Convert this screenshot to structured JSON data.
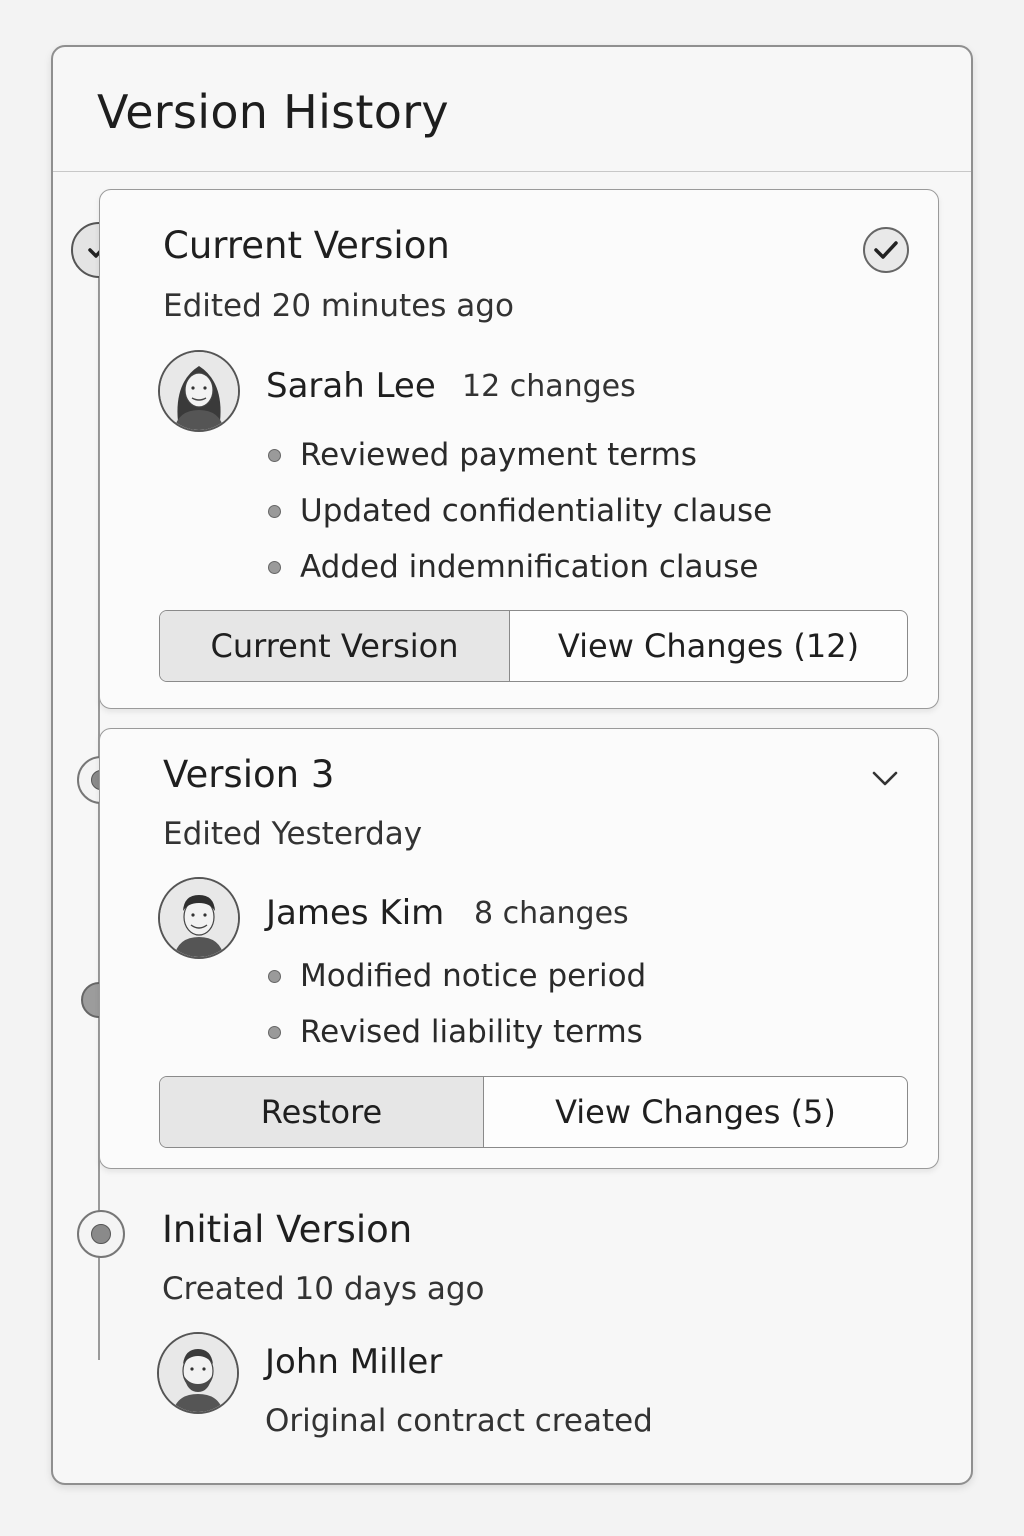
{
  "panel": {
    "title": "Version History"
  },
  "versions": [
    {
      "title": "Current Version",
      "subtitle": "Edited 20 minutes ago",
      "author": "Sarah Lee",
      "changes": "12 changes",
      "bullets": [
        "Reviewed payment terms",
        "Updated confidentiality clause",
        "Added indemnification clause"
      ],
      "primary_button": "Current Version",
      "secondary_button": "View Changes (12)",
      "status_icon": "check-icon"
    },
    {
      "title": "Version 3",
      "subtitle": "Edited Yesterday",
      "author": "James Kim",
      "changes": "8 changes",
      "bullets": [
        "Modified notice period",
        "Revised liability terms"
      ],
      "primary_button": "Restore",
      "secondary_button": "View Changes (5)",
      "status_icon": "chevron-down-icon"
    },
    {
      "title": "Initial Version",
      "subtitle": "Created 10 days ago",
      "author": "John Miller",
      "description": "Original contract created"
    }
  ],
  "colors": {
    "border": "#8f8f8f",
    "background": "#f3f3f3",
    "button_shaded": "#e6e6e6",
    "text": "#1f1f1f"
  }
}
